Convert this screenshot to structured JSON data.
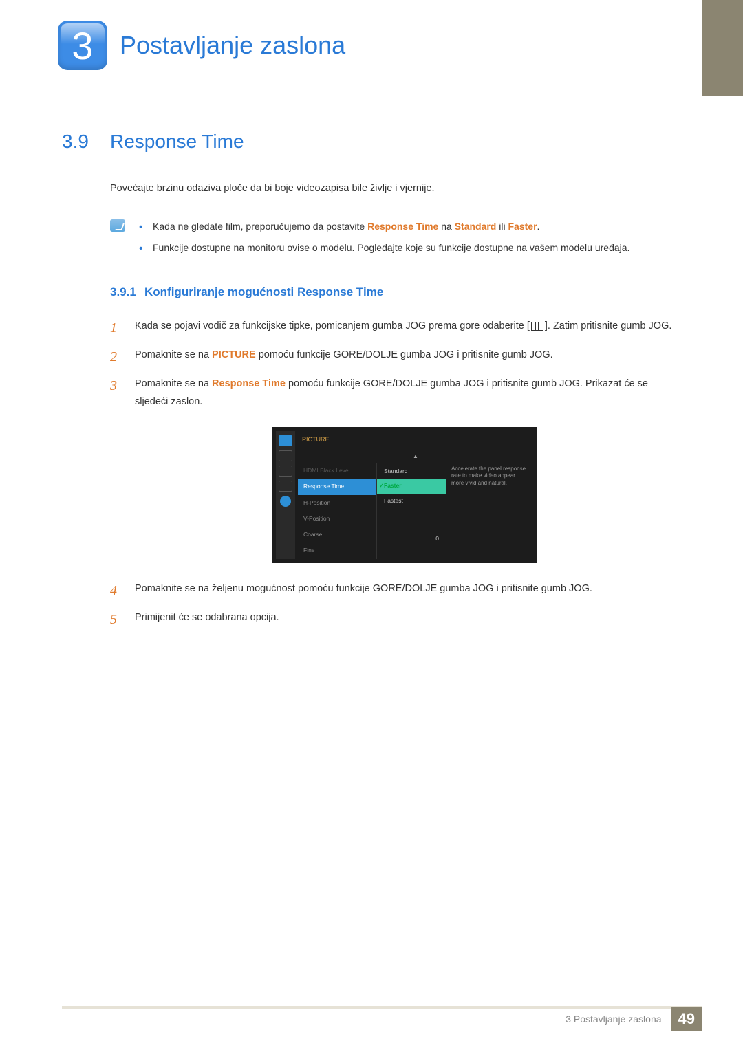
{
  "chapter": {
    "number": "3",
    "title": "Postavljanje zaslona"
  },
  "section": {
    "number": "3.9",
    "title": "Response Time"
  },
  "intro": "Povećajte brzinu odaziva ploče da bi boje videozapisa bile življe i vjernije.",
  "notes": [
    {
      "pre": "Kada ne gledate film, preporučujemo da postavite ",
      "b1": "Response Time",
      "mid": " na ",
      "b2": "Standard",
      "mid2": " ili ",
      "b3": "Faster",
      "post": "."
    },
    {
      "plain": "Funkcije dostupne na monitoru ovise o modelu. Pogledajte koje su funkcije dostupne na vašem modelu uređaja."
    }
  ],
  "subsection": {
    "number": "3.9.1",
    "title": "Konfiguriranje mogućnosti Response Time"
  },
  "steps": {
    "s1a": "Kada se pojavi vodič za funkcijske tipke, pomicanjem gumba JOG prema gore odaberite [",
    "s1b": "]. Zatim pritisnite gumb JOG.",
    "s2a": "Pomaknite se na ",
    "s2b": "PICTURE",
    "s2c": " pomoću funkcije GORE/DOLJE gumba JOG i pritisnite gumb JOG.",
    "s3a": "Pomaknite se na ",
    "s3b": "Response Time",
    "s3c": " pomoću funkcije GORE/DOLJE gumba JOG i pritisnite gumb JOG. Prikazat će se sljedeći zaslon.",
    "s4": "Pomaknite se na željenu mogućnost pomoću funkcije GORE/DOLJE gumba JOG i pritisnite gumb JOG.",
    "s5": "Primijenit će se odabrana opcija."
  },
  "osd": {
    "title": "PICTURE",
    "menu": [
      "HDMI Black Level",
      "Response Time",
      "H-Position",
      "V-Position",
      "Coarse"
    ],
    "fine_label": "Fine",
    "fine_value": "0",
    "sub": [
      "Standard",
      "Faster",
      "Fastest"
    ],
    "desc": "Accelerate the panel response rate to make video appear more vivid and natural."
  },
  "footer": {
    "text": "3 Postavljanje zaslona",
    "page": "49"
  }
}
